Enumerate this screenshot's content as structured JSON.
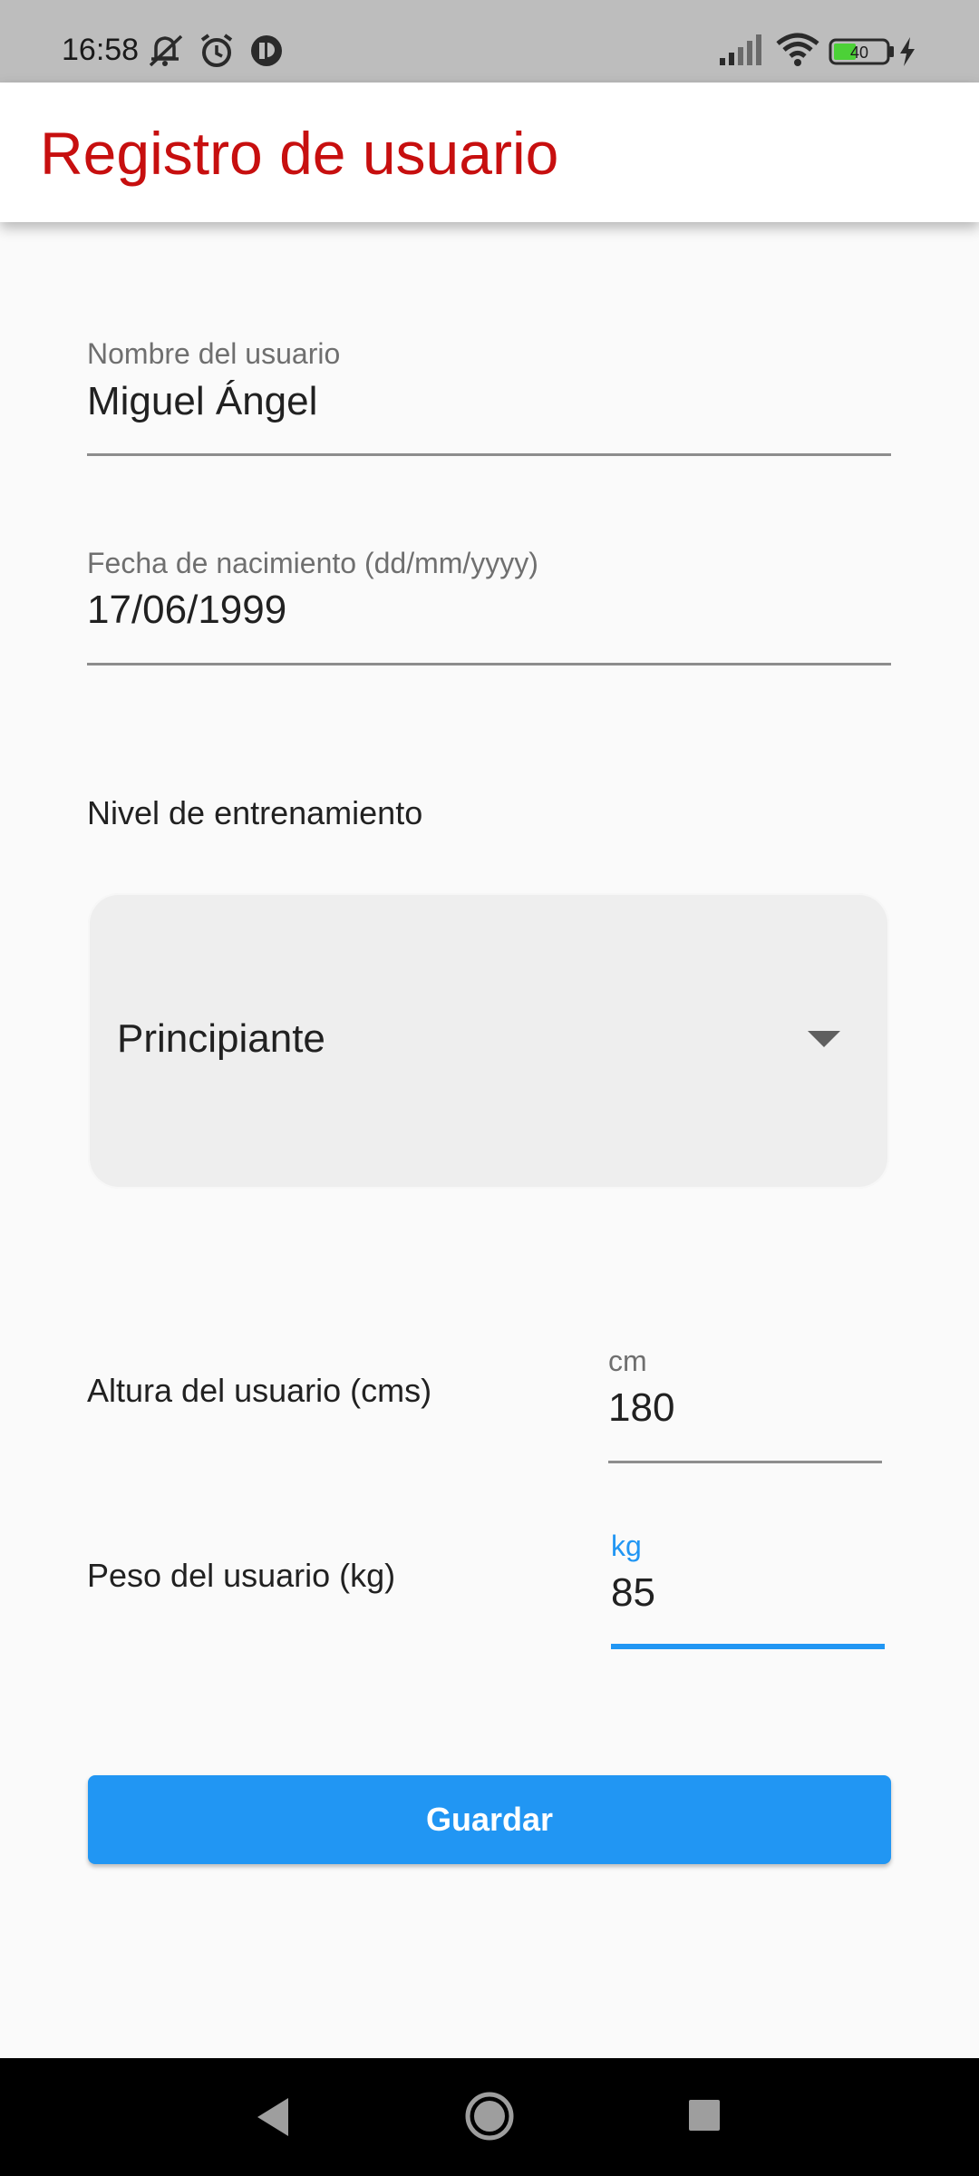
{
  "status_bar": {
    "time": "16:58",
    "icons_left": [
      "mute-bell-icon",
      "alarm-icon",
      "app-notification-icon"
    ],
    "icons_right": [
      "signal-icon",
      "wifi-icon",
      "battery-icon",
      "charging-icon"
    ],
    "battery": "40"
  },
  "app_bar": {
    "title": "Registro de usuario",
    "title_color": "#c70f0f"
  },
  "form": {
    "name": {
      "label": "Nombre del usuario",
      "value": "Miguel Ángel"
    },
    "birthdate": {
      "label": "Fecha de nacimiento (dd/mm/yyyy)",
      "value": "17/06/1999"
    },
    "training_level": {
      "label": "Nivel de entrenamiento",
      "selected": "Principiante"
    },
    "height": {
      "label": "Altura del usuario (cms)",
      "unit": "cm",
      "value": "180"
    },
    "weight": {
      "label": "Peso del usuario (kg)",
      "unit": "kg",
      "value": "85",
      "focused": true
    },
    "save_label": "Guardar"
  },
  "colors": {
    "accent": "#2196f3",
    "background": "#fafafa"
  },
  "nav_bar": {
    "icons": [
      "back-icon",
      "home-icon",
      "recents-icon"
    ]
  }
}
